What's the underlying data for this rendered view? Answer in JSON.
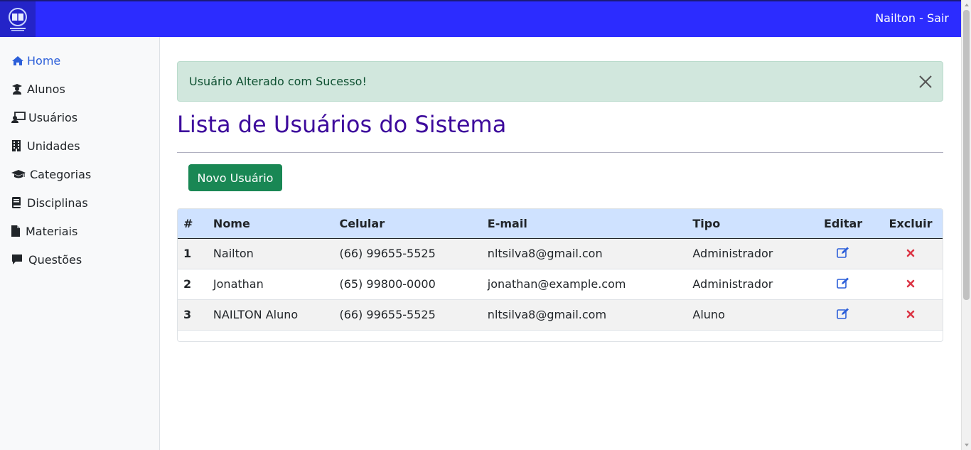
{
  "header": {
    "user_link": "Nailton - Sair"
  },
  "sidebar": {
    "items": [
      {
        "label": "Home",
        "icon": "home-icon"
      },
      {
        "label": "Alunos",
        "icon": "graduate-icon"
      },
      {
        "label": "Usuários",
        "icon": "teacher-icon"
      },
      {
        "label": "Unidades",
        "icon": "building-icon"
      },
      {
        "label": "Categorias",
        "icon": "graduation-cap-icon"
      },
      {
        "label": "Disciplinas",
        "icon": "book-icon"
      },
      {
        "label": "Materiais",
        "icon": "file-icon"
      },
      {
        "label": "Questões",
        "icon": "comment-icon"
      }
    ]
  },
  "alert": {
    "message": "Usuário Alterado com Sucesso!"
  },
  "page": {
    "title": "Lista de Usuários do Sistema",
    "new_button": "Novo Usuário"
  },
  "table": {
    "headers": [
      "#",
      "Nome",
      "Celular",
      "E-mail",
      "Tipo",
      "Editar",
      "Excluir"
    ],
    "rows": [
      {
        "id": "1",
        "nome": "Nailton",
        "celular": "(66) 99655-5525",
        "email": "nltsilva8@gmail.con",
        "tipo": "Administrador"
      },
      {
        "id": "2",
        "nome": "Jonathan",
        "celular": "(65) 99800-0000",
        "email": "jonathan@example.com",
        "tipo": "Administrador"
      },
      {
        "id": "3",
        "nome": "NAILTON Aluno",
        "celular": "(66) 99655-5525",
        "email": "nltsilva8@gmail.com",
        "tipo": "Aluno"
      }
    ]
  },
  "colors": {
    "topbar": "#2c2cff",
    "title": "#3d0a9c",
    "success": "#198754",
    "edit_icon": "#2c5fd9",
    "delete_icon": "#dc3545"
  }
}
